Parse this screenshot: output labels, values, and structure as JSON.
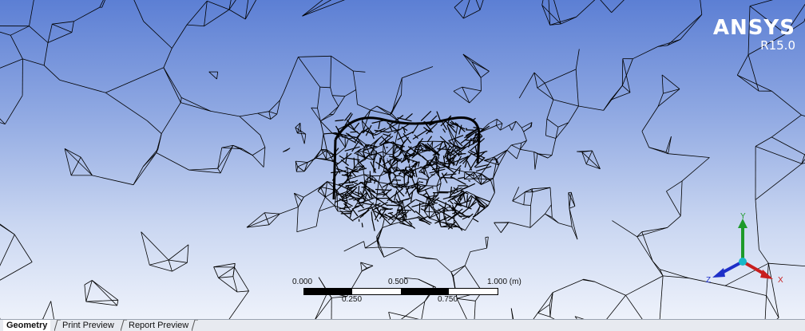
{
  "brand": {
    "name": "ANSYS",
    "version": "R15.0"
  },
  "scale_bar": {
    "label_start": "0.000",
    "label_mid": "0.500",
    "label_end": "1.000 (m)",
    "label_q1": "0.250",
    "label_q3": "0.750"
  },
  "triad": {
    "x_label": "X",
    "y_label": "Y",
    "z_label": "Z",
    "colors": {
      "x": "#c81e1e",
      "y": "#1e9a2a",
      "z": "#1e2fc8",
      "origin": "#18b8c8"
    }
  },
  "tabs": [
    {
      "label": "Geometry",
      "active": true
    },
    {
      "label": "Print Preview",
      "active": false
    },
    {
      "label": "Report Preview",
      "active": false
    }
  ],
  "colors": {
    "background_top": "#5c7fd4",
    "background_bottom": "#eef2fb",
    "mesh": "#000000"
  }
}
